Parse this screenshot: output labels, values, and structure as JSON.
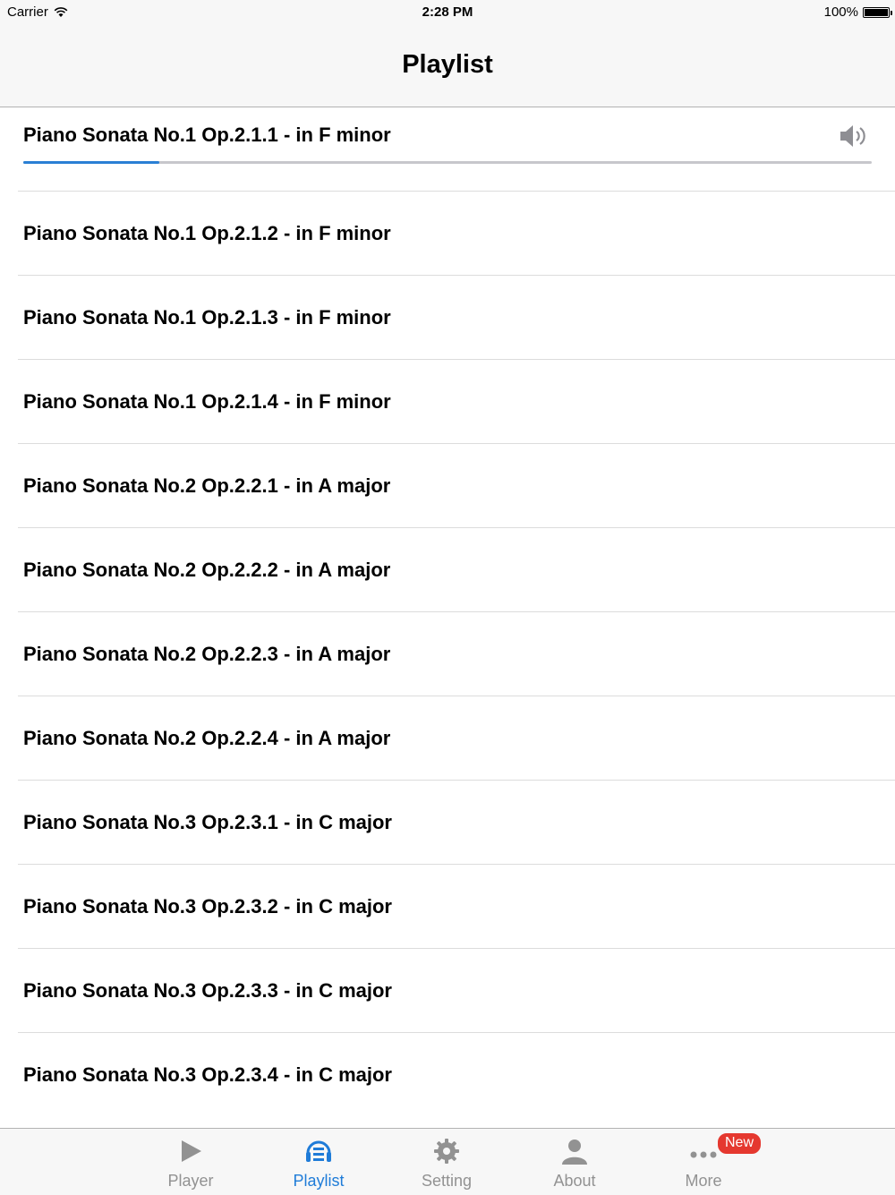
{
  "status": {
    "carrier": "Carrier",
    "time": "2:28 PM",
    "battery": "100%"
  },
  "nav": {
    "title": "Playlist"
  },
  "now_playing": {
    "title": "Piano Sonata No.1 Op.2.1.1 - in F minor",
    "progress": 0.16,
    "icon": "speaker-icon"
  },
  "tracks": [
    "Piano Sonata No.1 Op.2.1.2 - in F minor",
    "Piano Sonata No.1 Op.2.1.3 - in F minor",
    "Piano Sonata No.1 Op.2.1.4 - in F minor",
    "Piano Sonata No.2 Op.2.2.1 - in A major",
    "Piano Sonata No.2 Op.2.2.2 - in A major",
    "Piano Sonata No.2 Op.2.2.3 - in A major",
    "Piano Sonata No.2 Op.2.2.4 - in A major",
    "Piano Sonata No.3 Op.2.3.1 - in C major",
    "Piano Sonata No.3 Op.2.3.2 - in C major",
    "Piano Sonata No.3 Op.2.3.3 - in C major",
    "Piano Sonata No.3 Op.2.3.4 - in C major"
  ],
  "tabs": [
    {
      "label": "Player",
      "icon": "play-icon",
      "active": false
    },
    {
      "label": "Playlist",
      "icon": "playlist-icon",
      "active": true
    },
    {
      "label": "Setting",
      "icon": "gear-icon",
      "active": false
    },
    {
      "label": "About",
      "icon": "person-icon",
      "active": false
    },
    {
      "label": "More",
      "icon": "more-icon",
      "active": false
    }
  ],
  "more_badge": "New",
  "colors": {
    "accent": "#1f7cd8",
    "badge": "#e5382f",
    "inactive": "#929292"
  }
}
